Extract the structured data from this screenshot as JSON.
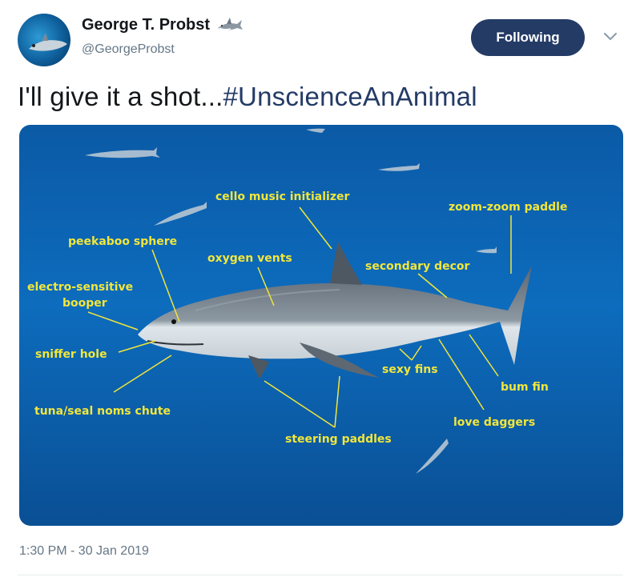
{
  "author": {
    "display_name": "George T. Probst",
    "handle": "@GeorgeProbst",
    "name_emoji_icon": "shark-icon",
    "avatar_icon": "shark-avatar"
  },
  "actions": {
    "follow_label": "Following",
    "menu_icon": "chevron-down-icon"
  },
  "tweet": {
    "text": "I'll give it a shot...",
    "hashtag": "#UnscienceAnAnimal",
    "timestamp": "1:30 PM - 30 Jan 2019"
  },
  "image": {
    "labels": [
      "cello music initializer",
      "zoom-zoom paddle",
      "peekaboo sphere",
      "oxygen vents",
      "secondary decor",
      "electro-sensitive",
      "booper",
      "sniffer hole",
      "sexy fins",
      "bum fin",
      "tuna/seal noms chute",
      "love daggers",
      "steering paddles"
    ]
  },
  "colors": {
    "button_bg": "#243b66",
    "hashtag": "#243b66",
    "label_yellow": "#f1e63a",
    "ocean": "#0a66b3",
    "secondary_text": "#657786"
  }
}
